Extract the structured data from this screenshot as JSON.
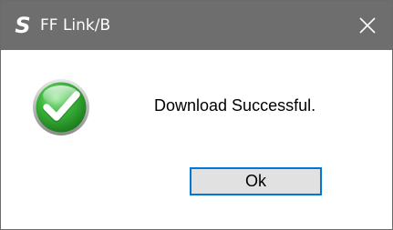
{
  "window": {
    "title": "FF Link/B",
    "app_icon": "S",
    "app_icon_name": "app-logo-s",
    "close_icon": "close-icon",
    "titlebar_color": "#6e6e6e"
  },
  "dialog": {
    "status_icon": "success-checkmark-icon",
    "message": "Download Successful.",
    "ok_label": "Ok",
    "accent_color": "#0078d7",
    "success_color": "#2e9e2e"
  }
}
